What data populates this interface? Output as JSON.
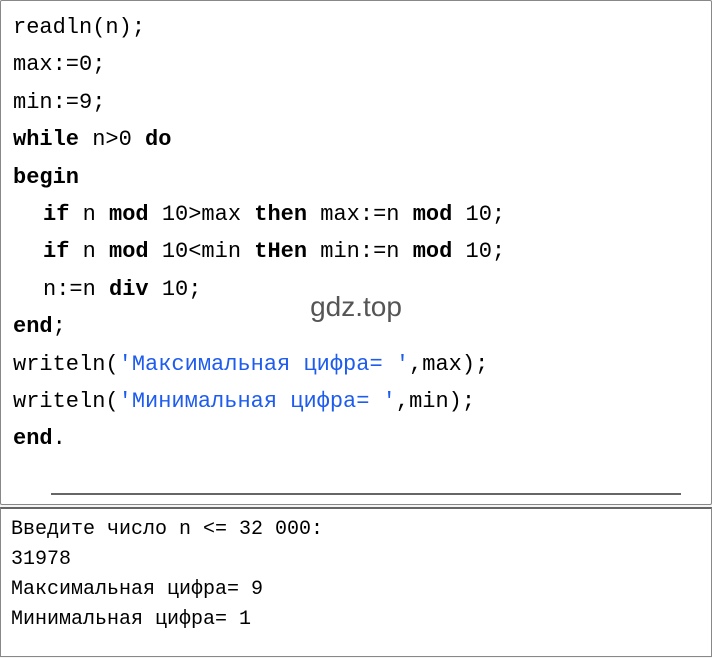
{
  "code": {
    "line1_part1": "readln(n);",
    "line2": "max:=0;",
    "line3": "min:=9;",
    "line4_kw1": "while",
    "line4_mid": " n>0 ",
    "line4_kw2": "do",
    "line5_kw": "begin",
    "line6_kw1": "if",
    "line6_mid1": " n ",
    "line6_kw2": "mod",
    "line6_mid2": " 10>max ",
    "line6_kw3": "then",
    "line6_mid3": " max:=n ",
    "line6_kw4": "mod",
    "line6_end": " 10;",
    "line7_kw1": "if",
    "line7_mid1": " n ",
    "line7_kw2": "mod",
    "line7_mid2": " 10<min ",
    "line7_kw3": "tHen",
    "line7_mid3": " min:=n ",
    "line7_kw4": "mod",
    "line7_end": " 10;",
    "line8_pre": "n:=n ",
    "line8_kw": "div",
    "line8_post": " 10;",
    "line9_kw": "end",
    "line9_post": ";",
    "line10_pre": "writeln(",
    "line10_str": "'Максимальная цифра= '",
    "line10_post": ",max);",
    "line11_pre": "writeln(",
    "line11_str": "'Минимальная цифра= '",
    "line11_post": ",min);",
    "line12_kw": "end",
    "line12_post": "."
  },
  "watermark": "gdz.top",
  "output": {
    "line1": "Введите число n <= 32 000:",
    "line2": "31978",
    "line3": "Максимальная цифра= 9",
    "line4": "Минимальная цифра= 1"
  }
}
